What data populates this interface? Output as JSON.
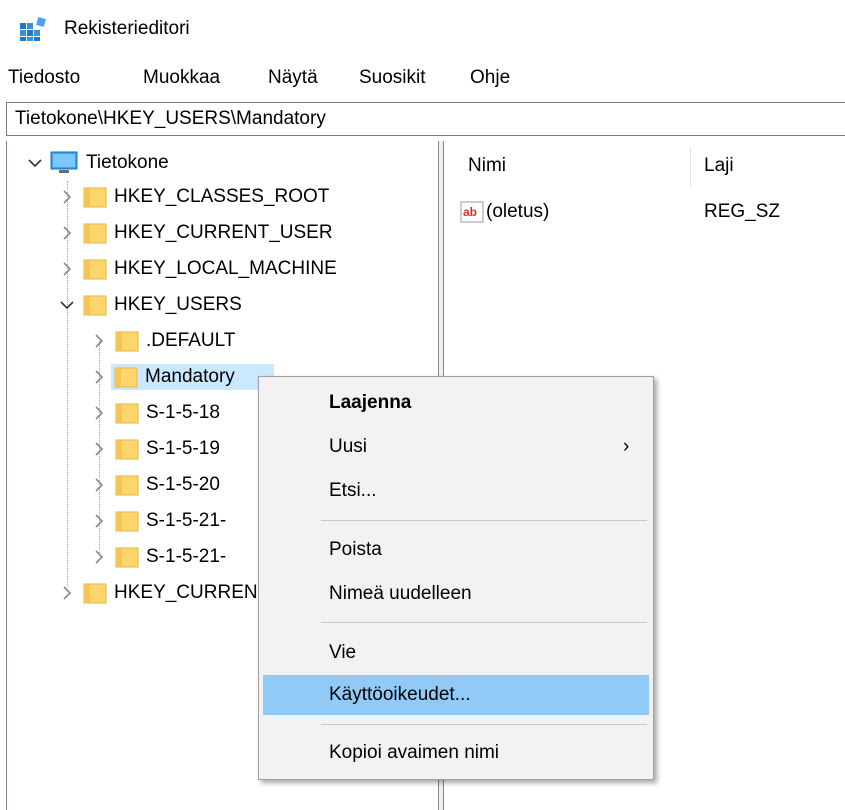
{
  "window": {
    "title": "Rekisterieditori"
  },
  "menu": [
    "Tiedosto",
    "Muokkaa",
    "Näytä",
    "Suosikit",
    "Ohje"
  ],
  "address": "Tietokone\\HKEY_USERS\\Mandatory",
  "tree": {
    "root": "Tietokone",
    "hives": [
      "HKEY_CLASSES_ROOT",
      "HKEY_CURRENT_USER",
      "HKEY_LOCAL_MACHINE",
      "HKEY_USERS"
    ],
    "users_children": [
      ".DEFAULT",
      "Mandatory",
      "S-1-5-18",
      "S-1-5-19",
      "S-1-5-20",
      "S-1-5-21-",
      "S-1-5-21-"
    ],
    "last_hive": "HKEY_CURRENT_CONFIG",
    "selected": "Mandatory"
  },
  "values": {
    "columns": {
      "name": "Nimi",
      "type": "Laji"
    },
    "rows": [
      {
        "name": "(oletus)",
        "type": "REG_SZ",
        "icon": "string-value-icon"
      }
    ]
  },
  "context_menu": {
    "expand": "Laajenna",
    "new": "Uusi",
    "new_arrow": "›",
    "find": "Etsi...",
    "delete": "Poista",
    "rename": "Nimeä uudelleen",
    "export": "Vie",
    "permissions": "Käyttöoikeudet...",
    "copy_key_name": "Kopioi avaimen nimi",
    "highlighted": "Käyttöoikeudet..."
  },
  "colors": {
    "selection": "#cce8ff",
    "menu_highlight": "#91c9f7",
    "folder": "#ffd66b"
  }
}
